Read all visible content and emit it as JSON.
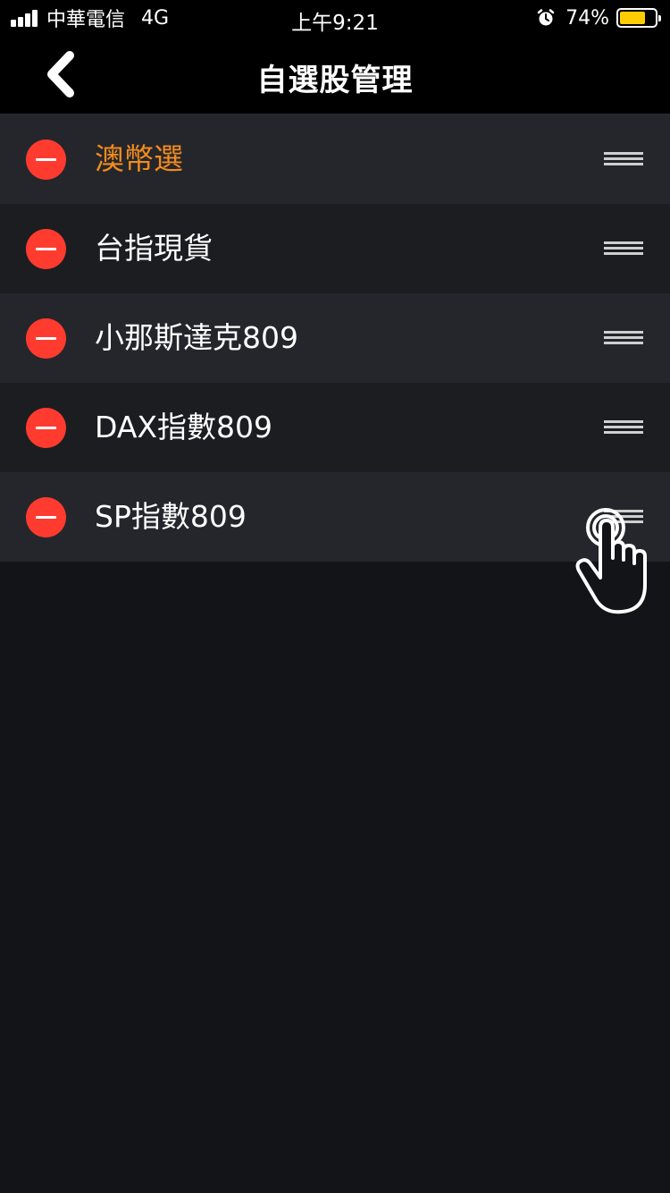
{
  "status_bar": {
    "carrier": "中華電信",
    "network": "4G",
    "time": "上午9:21",
    "battery_percent": "74%",
    "battery_level": 0.74,
    "battery_color": "#FFCC00",
    "alarm_icon": "alarm-clock-icon"
  },
  "nav": {
    "title": "自選股管理",
    "back_icon": "chevron-left-icon"
  },
  "colors": {
    "delete": "#FF3B30",
    "highlight": "#F28C1E"
  },
  "list": {
    "items": [
      {
        "label": "澳幣選",
        "highlighted": true
      },
      {
        "label": "台指現貨",
        "highlighted": false
      },
      {
        "label": "小那斯達克809",
        "highlighted": false
      },
      {
        "label": "DAX指數809",
        "highlighted": false
      },
      {
        "label": "SP指數809",
        "highlighted": false
      }
    ]
  },
  "overlay": {
    "icon": "tap-hand-icon"
  }
}
